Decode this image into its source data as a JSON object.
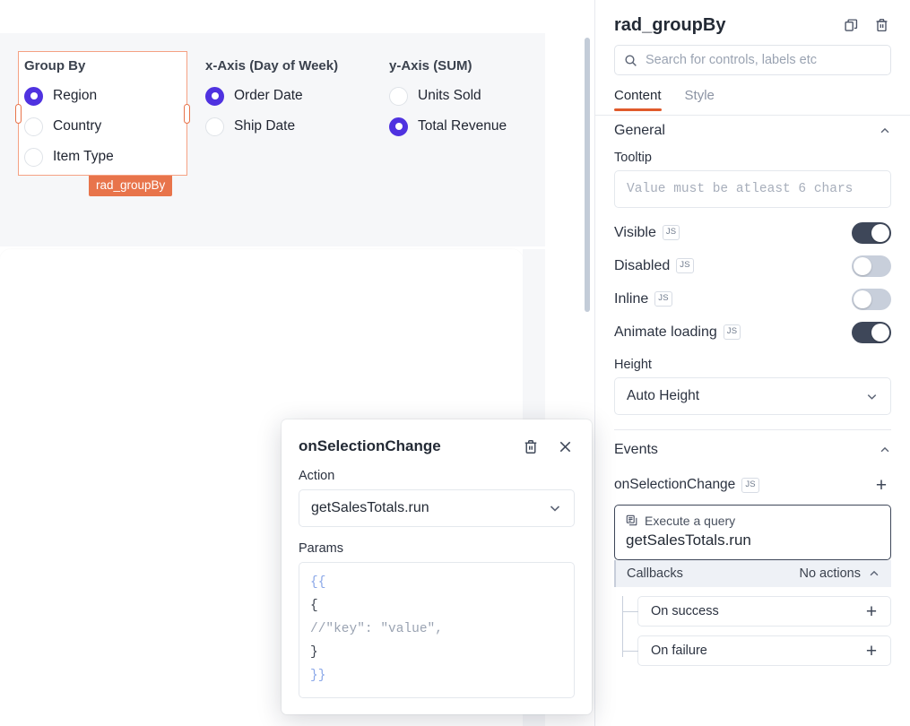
{
  "canvas": {
    "widget": {
      "name_tag": "rad_groupBy",
      "groups": [
        {
          "title": "Group By",
          "options": [
            {
              "label": "Region",
              "selected": true
            },
            {
              "label": "Country",
              "selected": false
            },
            {
              "label": "Item Type",
              "selected": false
            }
          ]
        },
        {
          "title": "x-Axis (Day of Week)",
          "options": [
            {
              "label": "Order Date",
              "selected": true
            },
            {
              "label": "Ship Date",
              "selected": false
            }
          ]
        },
        {
          "title": "y-Axis (SUM)",
          "options": [
            {
              "label": "Units Sold",
              "selected": false
            },
            {
              "label": "Total Revenue",
              "selected": true
            }
          ]
        }
      ]
    }
  },
  "property_pane": {
    "title": "rad_groupBy",
    "search": {
      "placeholder": "Search for controls, labels etc",
      "value": ""
    },
    "tabs": [
      {
        "label": "Content",
        "active": true
      },
      {
        "label": "Style",
        "active": false
      }
    ],
    "general": {
      "title": "General",
      "tooltip": {
        "label": "Tooltip",
        "placeholder": "Value must be atleast 6 chars",
        "value": ""
      },
      "toggles": [
        {
          "label": "Visible",
          "js": "JS",
          "on": true
        },
        {
          "label": "Disabled",
          "js": "JS",
          "on": false
        },
        {
          "label": "Inline",
          "js": "JS",
          "on": false
        },
        {
          "label": "Animate loading",
          "js": "JS",
          "on": true
        }
      ],
      "height": {
        "label": "Height",
        "value": "Auto Height"
      }
    },
    "events": {
      "title": "Events",
      "event_name": "onSelectionChange",
      "event_js": "JS",
      "add_label": "+",
      "action_card": {
        "kind": "Execute a query",
        "value": "getSalesTotals.run"
      },
      "callbacks": {
        "label": "Callbacks",
        "status": "No actions",
        "items": [
          {
            "label": "On success",
            "add": "+"
          },
          {
            "label": "On failure",
            "add": "+"
          }
        ]
      }
    }
  },
  "modal": {
    "title": "onSelectionChange",
    "action": {
      "label": "Action",
      "value": "getSalesTotals.run"
    },
    "params": {
      "label": "Params",
      "lines": [
        {
          "text": "{{",
          "kind": "brace"
        },
        {
          "text": "{",
          "kind": "plain"
        },
        {
          "text": " //\"key\": \"value\",",
          "kind": "comment"
        },
        {
          "text": "}",
          "kind": "plain"
        },
        {
          "text": "}}",
          "kind": "brace"
        }
      ]
    }
  },
  "colors": {
    "accent_orange": "#e8744b",
    "radio_purple": "#4f32e0",
    "toggle_on": "#3e4759",
    "tab_underline": "#e05a2b"
  }
}
